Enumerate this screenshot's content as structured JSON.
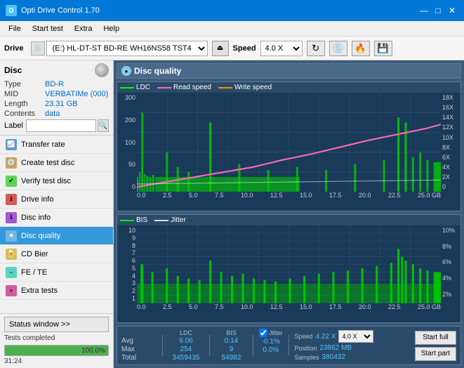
{
  "titleBar": {
    "title": "Opti Drive Control 1.70",
    "minBtn": "—",
    "maxBtn": "□",
    "closeBtn": "✕"
  },
  "menuBar": {
    "items": [
      "File",
      "Start test",
      "Extra",
      "Help"
    ]
  },
  "toolbar": {
    "driveLabel": "Drive",
    "driveValue": "(E:)  HL-DT-ST BD-RE  WH16NS58 TST4",
    "speedLabel": "Speed",
    "speedValue": "4.0 X"
  },
  "sidebar": {
    "discLabel": "Disc",
    "discFields": [
      {
        "label": "Type",
        "value": "BD-R"
      },
      {
        "label": "MID",
        "value": "VERBATIMe (000)"
      },
      {
        "label": "Length",
        "value": "23.31 GB"
      },
      {
        "label": "Contents",
        "value": "data"
      }
    ],
    "labelField": "Label",
    "navItems": [
      {
        "id": "transfer-rate",
        "label": "Transfer rate",
        "active": false
      },
      {
        "id": "create-test-disc",
        "label": "Create test disc",
        "active": false
      },
      {
        "id": "verify-test-disc",
        "label": "Verify test disc",
        "active": false
      },
      {
        "id": "drive-info",
        "label": "Drive info",
        "active": false
      },
      {
        "id": "disc-info",
        "label": "Disc info",
        "active": false
      },
      {
        "id": "disc-quality",
        "label": "Disc quality",
        "active": true
      },
      {
        "id": "cd-bier",
        "label": "CD Bier",
        "active": false
      },
      {
        "id": "fe-te",
        "label": "FE / TE",
        "active": false
      },
      {
        "id": "extra-tests",
        "label": "Extra tests",
        "active": false
      }
    ],
    "statusWindowBtn": "Status window >>",
    "statusText": "Tests completed",
    "statusPercent": 100,
    "statusPercentLabel": "100.0%",
    "statusTime": "31:24"
  },
  "content": {
    "title": "Disc quality",
    "chart1": {
      "legend": [
        {
          "label": "LDC",
          "color": "#00ff00"
        },
        {
          "label": "Read speed",
          "color": "#ff69b4"
        },
        {
          "label": "Write speed",
          "color": "#ff8c00"
        }
      ],
      "yAxisLeft": [
        "300",
        "200",
        "100",
        "50",
        "0"
      ],
      "yAxisRight": [
        "18X",
        "16X",
        "14X",
        "12X",
        "10X",
        "8X",
        "6X",
        "4X",
        "2X",
        "0"
      ],
      "xAxis": [
        "0.0",
        "2.5",
        "5.0",
        "7.5",
        "10.0",
        "12.5",
        "15.0",
        "17.5",
        "20.0",
        "22.5",
        "25.0 GB"
      ]
    },
    "chart2": {
      "legend": [
        {
          "label": "BIS",
          "color": "#00ff00"
        },
        {
          "label": "Jitter",
          "color": "#e0e0e0"
        }
      ],
      "yAxisLeft": [
        "10",
        "9",
        "8",
        "7",
        "6",
        "5",
        "4",
        "3",
        "2",
        "1"
      ],
      "yAxisRight": [
        "10%",
        "8%",
        "6%",
        "4%",
        "2%"
      ],
      "xAxis": [
        "0.0",
        "2.5",
        "5.0",
        "7.5",
        "10.0",
        "12.5",
        "15.0",
        "17.5",
        "20.0",
        "22.5",
        "25.0 GB"
      ]
    },
    "stats": {
      "columns": [
        "LDC",
        "BIS",
        "",
        "Jitter"
      ],
      "rows": [
        {
          "label": "Avg",
          "ldc": "9.06",
          "bis": "0.14",
          "jitter": "-0.1%"
        },
        {
          "label": "Max",
          "ldc": "254",
          "bis": "9",
          "jitter": "0.0%"
        },
        {
          "label": "Total",
          "ldc": "3459435",
          "bis": "54982",
          "jitter": ""
        }
      ],
      "jitterChecked": true,
      "speedLabel": "Speed",
      "speedValue": "4.22 X",
      "speedSelect": "4.0 X",
      "positionLabel": "Position",
      "positionValue": "23862 MB",
      "samplesLabel": "Samples",
      "samplesValue": "380432",
      "startFullBtn": "Start full",
      "startPartBtn": "Start part"
    }
  }
}
